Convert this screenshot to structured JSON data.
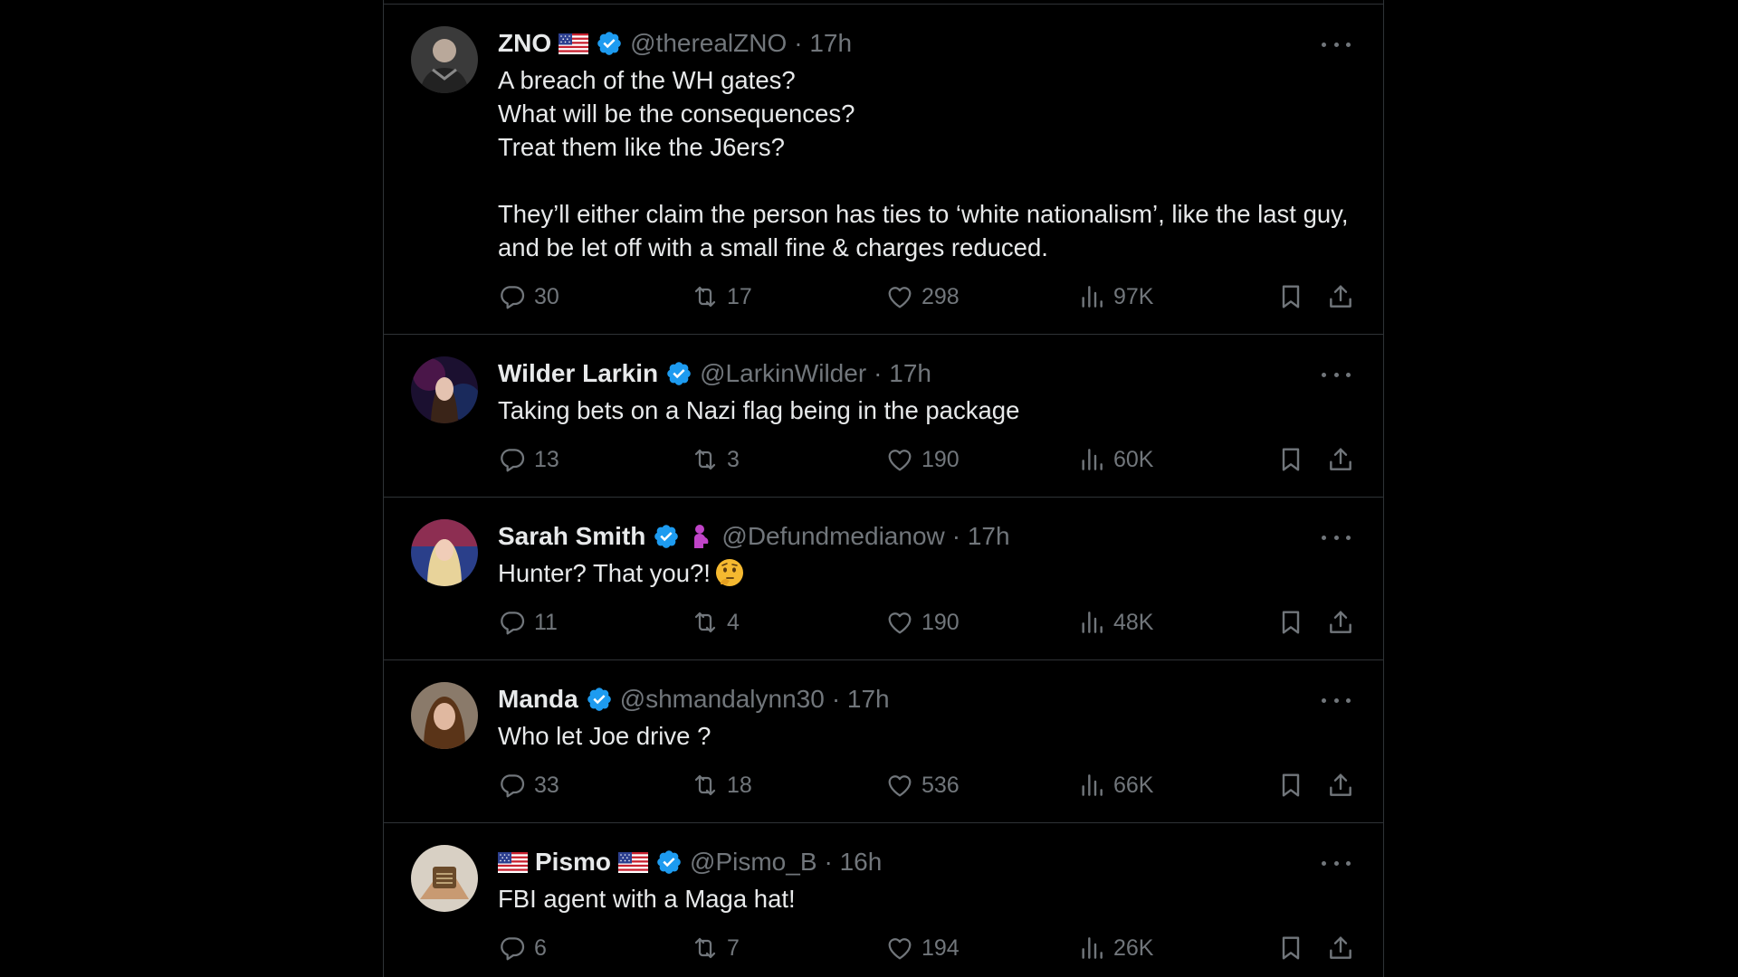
{
  "tweets": [
    {
      "name": "ZNO",
      "handle": "@therealZNO",
      "time": "· 17h",
      "text": "A breach of the WH gates?\nWhat will be the consequences?\nTreat them like the J6ers?\n\nThey’ll either claim the person has ties to ‘white nationalism’, like the last guy, and be let off with a small fine & charges reduced.",
      "replies": "30",
      "reposts": "17",
      "likes": "298",
      "views": "97K"
    },
    {
      "name": "Wilder Larkin",
      "handle": "@LarkinWilder",
      "time": "· 17h",
      "text": "Taking bets on a Nazi flag being in the package",
      "replies": "13",
      "reposts": "3",
      "likes": "190",
      "views": "60K"
    },
    {
      "name": "Sarah Smith",
      "handle": "@Defundmedianow",
      "time": "· 17h",
      "text": "Hunter? That you?!",
      "replies": "11",
      "reposts": "4",
      "likes": "190",
      "views": "48K"
    },
    {
      "name": "Manda",
      "handle": "@shmandalynn30",
      "time": "· 17h",
      "text": "Who let Joe drive ?",
      "replies": "33",
      "reposts": "18",
      "likes": "536",
      "views": "66K"
    },
    {
      "name": "Pismo",
      "handle": "@Pismo_B",
      "time": "· 16h",
      "text": "FBI agent with a Maga hat!",
      "replies": "6",
      "reposts": "7",
      "likes": "194",
      "views": "26K"
    }
  ],
  "colors": {
    "verified": "#1d9bf0",
    "muted": "#71767b",
    "text": "#e7e9ea",
    "divider": "#2f3336"
  }
}
